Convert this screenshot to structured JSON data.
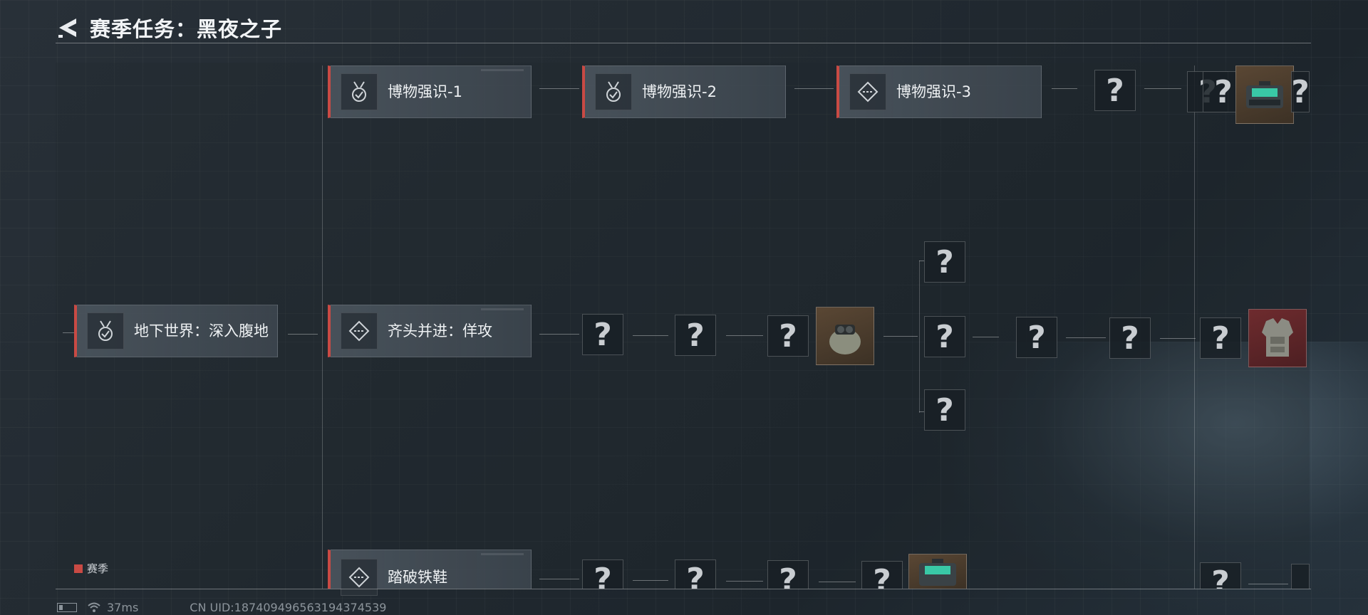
{
  "header": {
    "title": "赛季任务：黑夜之子"
  },
  "quests": {
    "root": {
      "label": "地下世界：深入腹地"
    },
    "row1": [
      {
        "label": "博物强识-1",
        "icon": "medal-check-icon"
      },
      {
        "label": "博物强识-2",
        "icon": "medal-check-icon"
      },
      {
        "label": "博物强识-3",
        "icon": "diamond-dash-icon"
      }
    ],
    "row2": {
      "label": "齐头并进：佯攻",
      "icon": "diamond-dash-icon"
    },
    "row3": {
      "label": "踏破铁鞋",
      "icon": "diamond-dash-icon"
    }
  },
  "unknown_mark": "?",
  "rewards": {
    "row1": "equipment-case-icon",
    "row2_mid": "night-vision-helmet-icon",
    "row2_end": "body-armor-icon",
    "row3": "equipment-case-icon"
  },
  "legend": {
    "label": "赛季",
    "color": "#c94a44"
  },
  "status": {
    "ping": "37ms",
    "uid": "CN UID:187409496563194374539"
  }
}
